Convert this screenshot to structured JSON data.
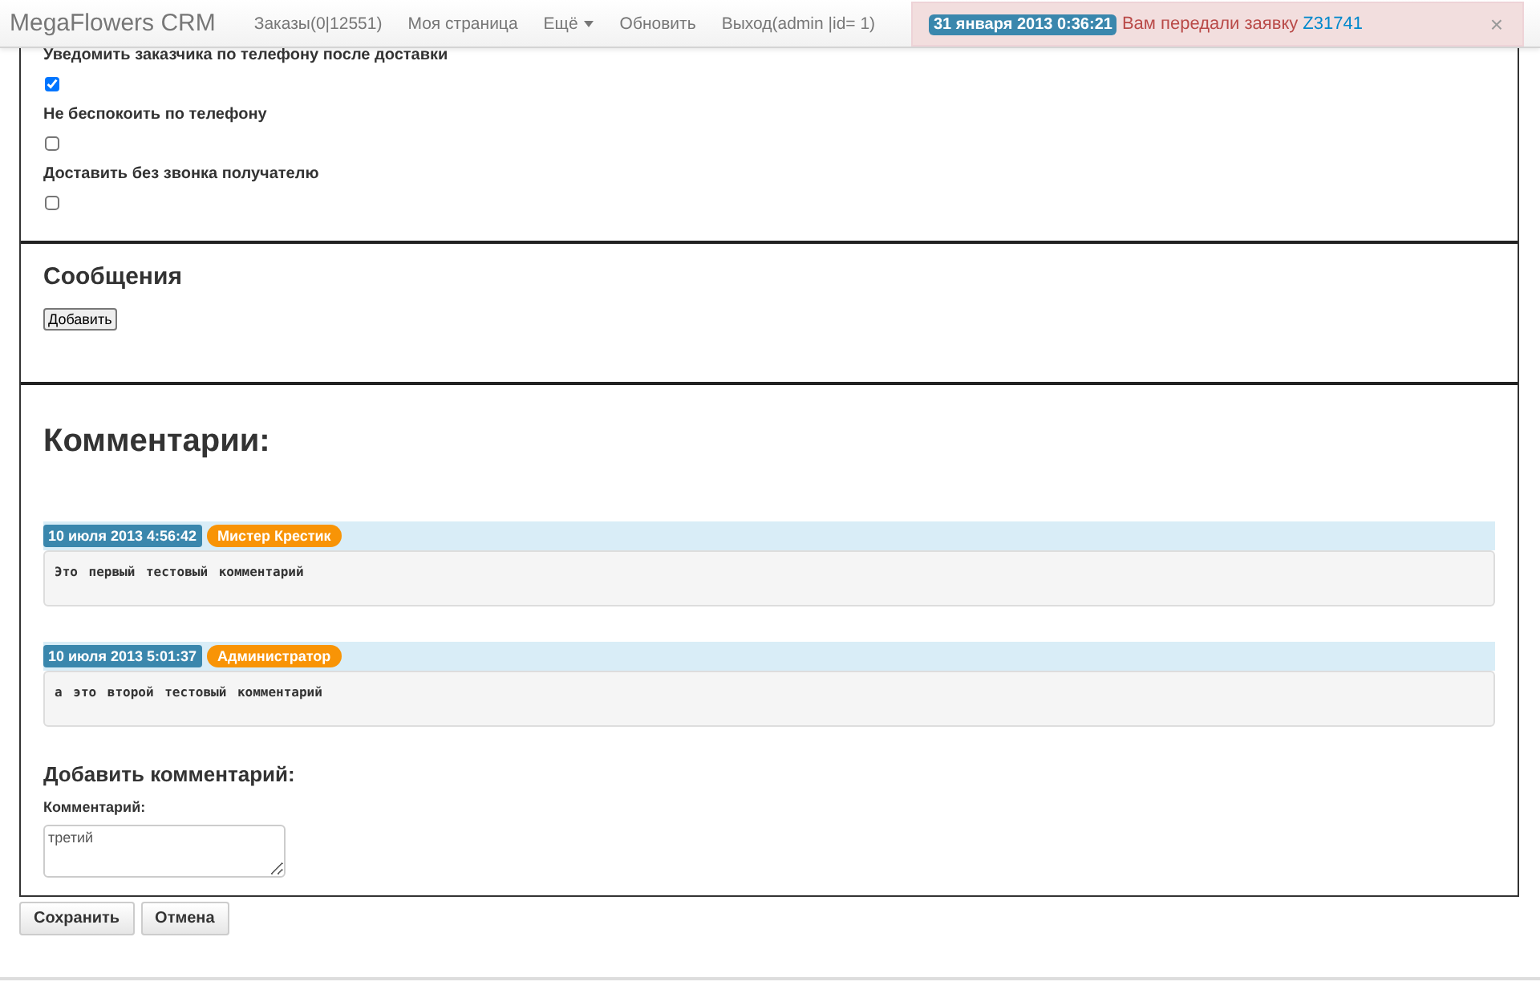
{
  "navbar": {
    "brand": "MegaFlowers CRM",
    "items": [
      {
        "label": "Заказы(0|12551)",
        "kind": "link"
      },
      {
        "label": "Моя страница",
        "kind": "link"
      },
      {
        "label": "Ещё",
        "kind": "dropdown"
      },
      {
        "label": "Обновить",
        "kind": "link"
      },
      {
        "label": "Выход(admin |id= 1)",
        "kind": "link"
      }
    ]
  },
  "notification": {
    "date": "31 января 2013 0:36:21",
    "message": "Вам передали заявку",
    "link": "Z31741",
    "close": "×"
  },
  "options": [
    {
      "label": "Уведомить заказчика по телефону после доставки",
      "checked": true
    },
    {
      "label": "Не беспокоить по телефону",
      "checked": false
    },
    {
      "label": "Доставить без звонка получателю",
      "checked": false
    }
  ],
  "messages": {
    "title": "Сообщения",
    "button": "Добавить"
  },
  "comments": {
    "title": "Комментарии:",
    "items": [
      {
        "date": "10 июля 2013 4:56:42",
        "author": "Мистер Крестик",
        "text": "Это первый тестовый комментарий"
      },
      {
        "date": "10 июля 2013 5:01:37",
        "author": "Администратор",
        "text": "а это второй тестовый комментарий"
      }
    ]
  },
  "add_comment": {
    "title": "Добавить комментарий:",
    "label": "Комментарий:",
    "value": "третий"
  },
  "buttons": [
    "Сохранить",
    "Отмена"
  ]
}
